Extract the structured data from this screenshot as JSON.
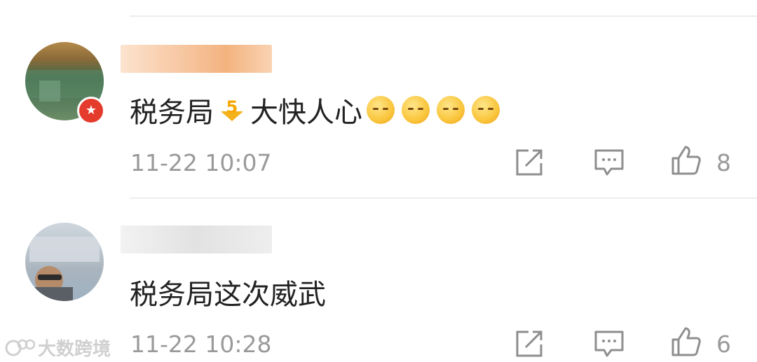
{
  "comments": [
    {
      "text": "税务局",
      "text_after": " 大快人心",
      "time": "11-22 10:07",
      "likes": "8"
    },
    {
      "text": "税务局这次威武",
      "time": "11-22 10:28",
      "likes": "6"
    }
  ],
  "watermark": "大数跨境",
  "icons": [
    "share-icon",
    "comment-icon",
    "like-icon"
  ],
  "colors": {
    "text": "#222222",
    "meta": "#9a9a9a",
    "badge": "#e53b2c"
  }
}
